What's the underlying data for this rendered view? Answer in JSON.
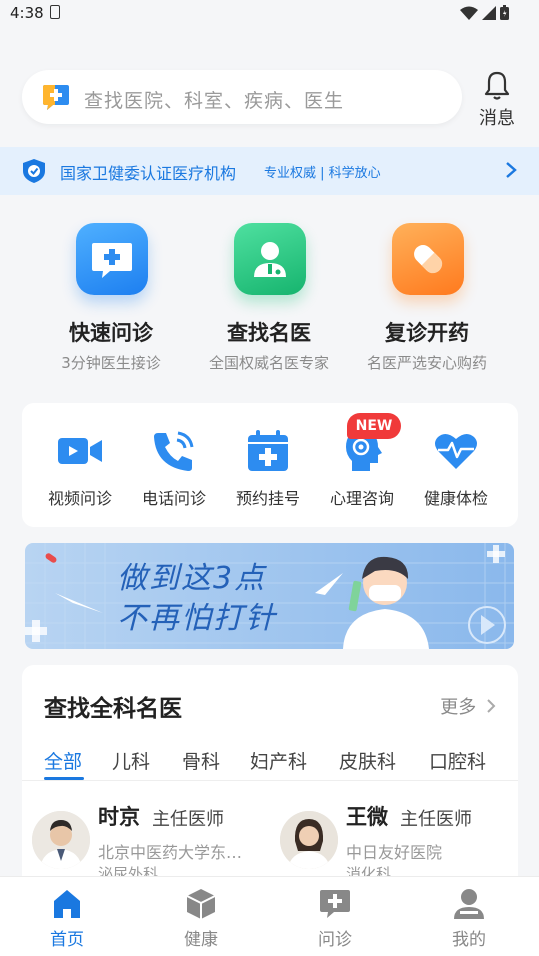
{
  "status_bar": {
    "time": "4:38"
  },
  "search": {
    "placeholder": "查找医院、科室、疾病、医生"
  },
  "header": {
    "message_label": "消息"
  },
  "cert_banner": {
    "main_text": "国家卫健委认证医疗机构",
    "sub_text": "专业权威 | 科学放心"
  },
  "services": [
    {
      "title": "快速问诊",
      "desc": "3分钟医生接诊",
      "color": "#2d8cf0"
    },
    {
      "title": "查找名医",
      "desc": "全国权威名医专家",
      "color": "#21c47e"
    },
    {
      "title": "复诊开药",
      "desc": "名医严选安心购药",
      "color": "#ff8a2a"
    }
  ],
  "quick_actions": [
    {
      "label": "视频问诊",
      "icon": "video-camera-icon"
    },
    {
      "label": "电话问诊",
      "icon": "phone-icon"
    },
    {
      "label": "预约挂号",
      "icon": "calendar-plus-icon"
    },
    {
      "label": "心理咨询",
      "icon": "head-icon"
    },
    {
      "label": "健康体检",
      "icon": "heart-pulse-icon"
    }
  ],
  "new_badge": "NEW",
  "promo_banner": {
    "line1": "做到这3点",
    "line2": "不再怕打针"
  },
  "doctors": {
    "title": "查找全科名医",
    "more": "更多",
    "tabs": [
      "全部",
      "儿科",
      "骨科",
      "妇产科",
      "皮肤科",
      "口腔科"
    ],
    "items": [
      {
        "name": "时京",
        "rank": "主任医师",
        "hospital": "北京中医药大学东直门医院",
        "dept": "泌尿外科"
      },
      {
        "name": "王微",
        "rank": "主任医师",
        "hospital": "中日友好医院",
        "dept": "消化科"
      }
    ]
  },
  "tabbar": [
    {
      "label": "首页",
      "active": true
    },
    {
      "label": "健康",
      "active": false
    },
    {
      "label": "问诊",
      "active": false
    },
    {
      "label": "我的",
      "active": false
    }
  ],
  "colors": {
    "primary": "#1a78e0",
    "badge": "#f03a3a"
  }
}
